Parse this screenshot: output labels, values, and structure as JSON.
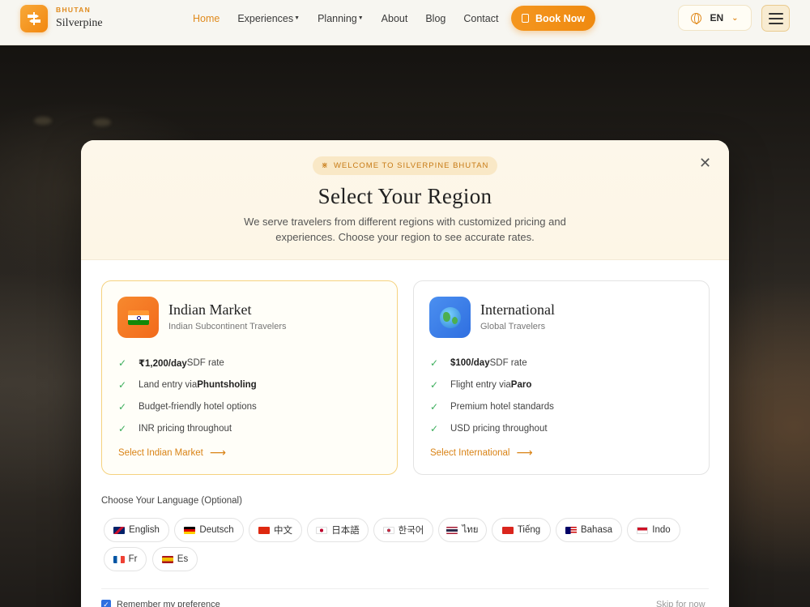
{
  "header": {
    "brand_small": "BHUTAN",
    "brand_name": "Silverpine",
    "nav": [
      {
        "label": "Home",
        "active": true,
        "dropdown": false
      },
      {
        "label": "Experiences",
        "active": false,
        "dropdown": true
      },
      {
        "label": "Planning",
        "active": false,
        "dropdown": true
      },
      {
        "label": "About",
        "active": false,
        "dropdown": false
      },
      {
        "label": "Blog",
        "active": false,
        "dropdown": false
      },
      {
        "label": "Contact",
        "active": false,
        "dropdown": false
      }
    ],
    "book_label": "Book Now",
    "language": "EN",
    "accent": "#ef8a10"
  },
  "modal": {
    "badge": "WELCOME TO SILVERPINE BHUTAN",
    "title": "Select Your Region",
    "description": "We serve travelers from different regions with customized pricing and experiences. Choose your region to see accurate rates.",
    "regions": [
      {
        "title": "Indian Market",
        "subtitle": "Indian Subcontinent Travelers",
        "icon": "india-flag-icon",
        "features": [
          {
            "bold": "₹1,200/day",
            "text": " SDF rate",
            "bold_first": true
          },
          {
            "text": "Land entry via ",
            "bold": "Phuntsholing",
            "bold_first": false
          },
          {
            "text": "Budget-friendly hotel options"
          },
          {
            "text": "INR pricing throughout"
          }
        ],
        "link": "Select Indian Market"
      },
      {
        "title": "International",
        "subtitle": "Global Travelers",
        "icon": "globe-icon",
        "features": [
          {
            "bold": "$100/day",
            "text": " SDF rate",
            "bold_first": true
          },
          {
            "text": "Flight entry via ",
            "bold": "Paro",
            "bold_first": false
          },
          {
            "text": "Premium hotel standards"
          },
          {
            "text": "USD pricing throughout"
          }
        ],
        "link": "Select International"
      }
    ],
    "language_label": "Choose Your Language (Optional)",
    "languages": [
      {
        "label": "English",
        "flag": "uk"
      },
      {
        "label": "Deutsch",
        "flag": "de"
      },
      {
        "label": "中文",
        "flag": "cn"
      },
      {
        "label": "日本語",
        "flag": "jp"
      },
      {
        "label": "한국어",
        "flag": "kr"
      },
      {
        "label": "ไทย",
        "flag": "th"
      },
      {
        "label": "Tiếng",
        "flag": "vn"
      },
      {
        "label": "Bahasa",
        "flag": "my"
      },
      {
        "label": "Indo",
        "flag": "id"
      },
      {
        "label": "Fr",
        "flag": "fr"
      },
      {
        "label": "Es",
        "flag": "es"
      }
    ],
    "remember_label": "Remember my preference",
    "remember_checked": true,
    "skip_label": "Skip for now"
  }
}
